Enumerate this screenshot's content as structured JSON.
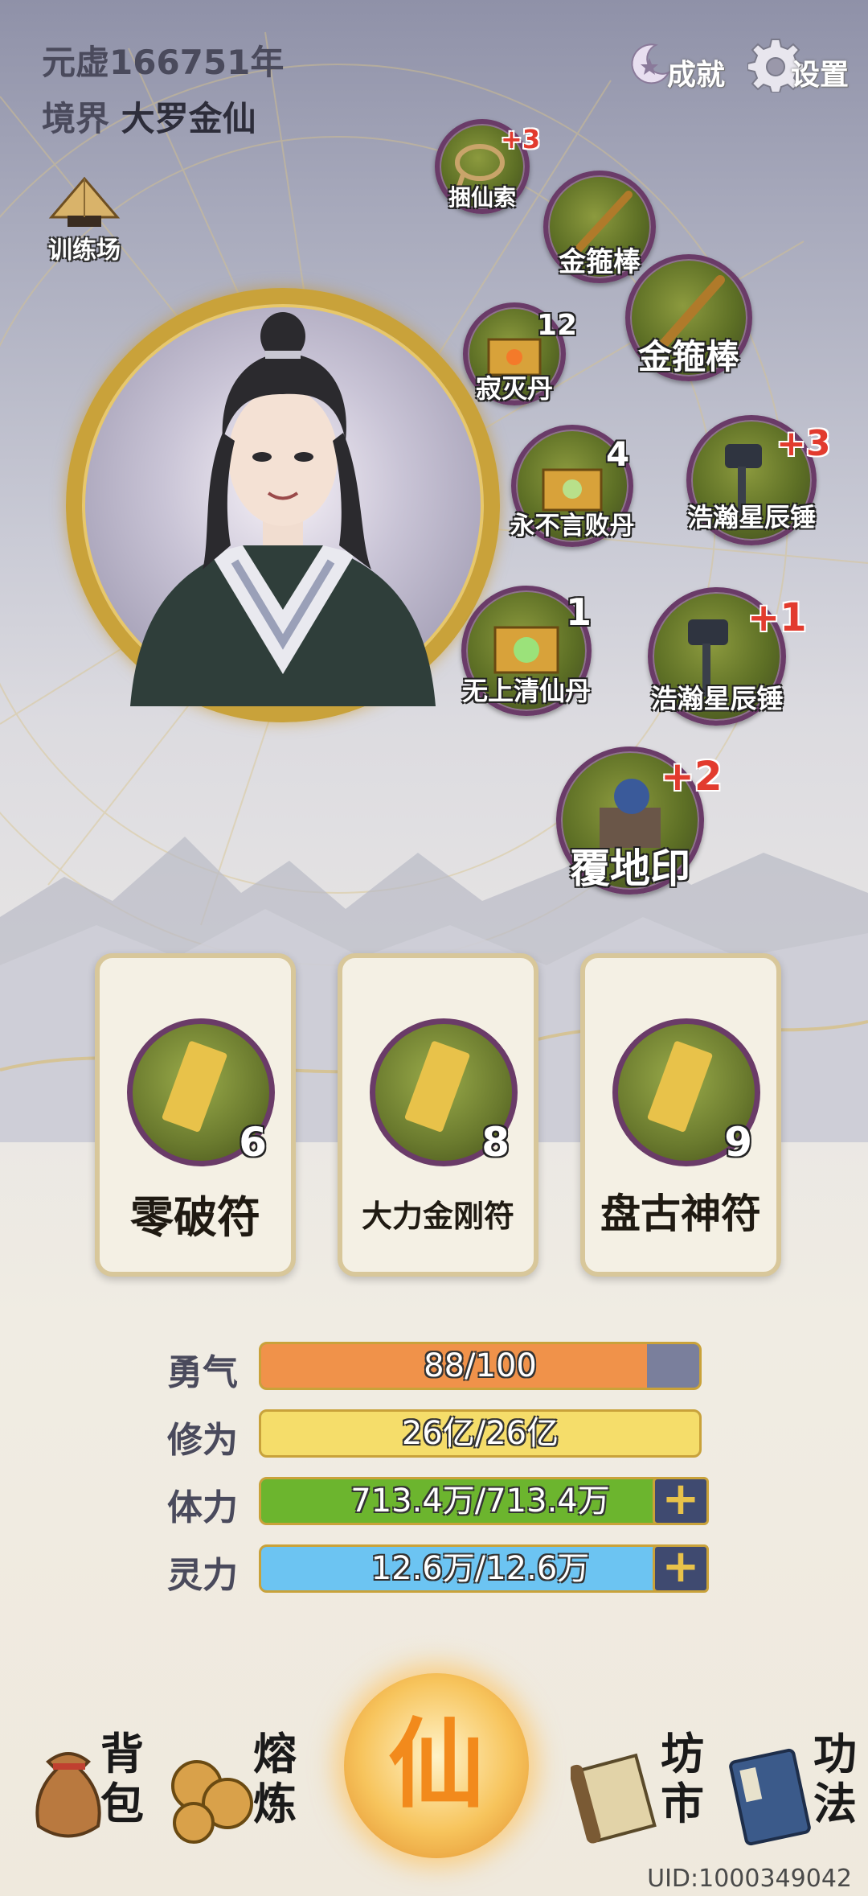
{
  "header": {
    "era": "元虚166751年",
    "realm_label": "境界",
    "realm_value": "大罗金仙",
    "achievements_label": "成就",
    "settings_label": "设置",
    "training_label": "训练场"
  },
  "items": [
    {
      "name": "捆仙索",
      "level": "+3",
      "count": ""
    },
    {
      "name": "金箍棒",
      "level": "",
      "count": ""
    },
    {
      "name": "金箍棒",
      "level": "",
      "count": ""
    },
    {
      "name": "寂灭丹",
      "level": "",
      "count": "12"
    },
    {
      "name": "永不言败丹",
      "level": "",
      "count": "4"
    },
    {
      "name": "浩瀚星辰锤",
      "level": "+3",
      "count": ""
    },
    {
      "name": "无上清仙丹",
      "level": "",
      "count": "1"
    },
    {
      "name": "浩瀚星辰锤",
      "level": "+1",
      "count": ""
    },
    {
      "name": "覆地印",
      "level": "+2",
      "count": ""
    }
  ],
  "talismans": [
    {
      "name": "零破符",
      "count": "6"
    },
    {
      "name": "大力金刚符",
      "count": "8"
    },
    {
      "name": "盘古神符",
      "count": "9"
    }
  ],
  "stats": [
    {
      "label": "勇气",
      "value": "88/100",
      "fraction": 0.88,
      "color": "#f0924a"
    },
    {
      "label": "修为",
      "value": "26亿/26亿",
      "fraction": 1.0,
      "color": "#f5dd6a"
    },
    {
      "label": "体力",
      "value": "713.4万/713.4万",
      "fraction": 1.0,
      "color": "#6cb52e"
    },
    {
      "label": "灵力",
      "value": "12.6万/12.6万",
      "fraction": 1.0,
      "color": "#6cc4f2"
    }
  ],
  "nav": {
    "bag": [
      "背",
      "包"
    ],
    "smelt": [
      "熔",
      "炼"
    ],
    "center": "仙",
    "market": [
      "坊",
      "市"
    ],
    "skills": [
      "功",
      "法"
    ]
  },
  "uid": "UID:1000349042"
}
